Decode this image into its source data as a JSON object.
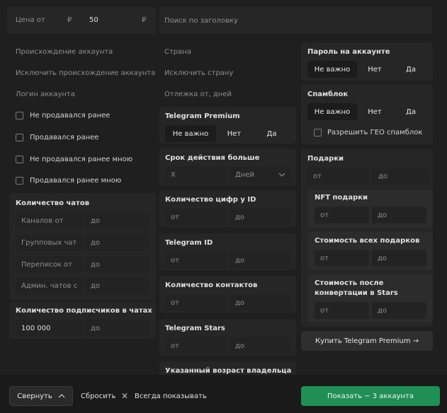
{
  "price": {
    "from_label": "Цена от",
    "currency_left": "₽",
    "value": "50",
    "currency_right": "₽"
  },
  "search": {
    "placeholder": "Поиск по заголовку"
  },
  "col1": {
    "origin": "Происхождение аккаунта",
    "exclude_origin": "Исключить происхождение аккаунта",
    "login": "Логин аккаунта",
    "checks": [
      "Не продавался ранее",
      "Продавался ранее",
      "Не продавался ранее мною",
      "Продавался ранее мною"
    ],
    "chats_title": "Количество чатов",
    "chat_rows": [
      {
        "from": "Каналов от",
        "to": "до"
      },
      {
        "from": "Групповых чат",
        "to": "до"
      },
      {
        "from": "Переписок от",
        "to": "до"
      },
      {
        "from": "Админ. чатов с",
        "to": "до"
      }
    ],
    "subs_title": "Количество подписчиков в чатах",
    "subs_from": "100 000",
    "subs_to": "до"
  },
  "col2": {
    "country": "Страна",
    "exclude_country": "Исключить страну",
    "holdout": "Отлежка от, дней",
    "premium_title": "Telegram Premium",
    "premium_options": [
      "Не важно",
      "Нет",
      "Да"
    ],
    "validity_title": "Срок действия больше",
    "validity_x": "X",
    "validity_unit": "Дней",
    "digits_title": "Количество цифр у ID",
    "id_title": "Telegram ID",
    "contacts_title": "Количество контактов",
    "stars_title": "Telegram Stars",
    "owner_age_title": "Указанный возраст владельца",
    "from": "от",
    "to": "до"
  },
  "col3": {
    "password_title": "Пароль на аккаунте",
    "password_options": [
      "Не важно",
      "Нет",
      "Да"
    ],
    "spamblock_title": "Спамблок",
    "spamblock_options": [
      "Не важно",
      "Нет",
      "Да"
    ],
    "geo_spamblock": "Разрешить ГЕО спамблок",
    "gifts_title": "Подарки",
    "nft_title": "NFT подарки",
    "gifts_cost_title": "Стоимость всех подарков",
    "conv_title_1": "Стоимость после",
    "conv_title_2": "конвертации в Stars",
    "from": "от",
    "to": "до",
    "buy_premium": "Купить Telegram Premium →"
  },
  "footer": {
    "collapse": "Свернуть",
    "reset": "Сбросить",
    "always_show": "Всегда показывать",
    "show_accounts": "Показать ~ 3 аккаунта",
    "accent": "#1f8f55"
  }
}
